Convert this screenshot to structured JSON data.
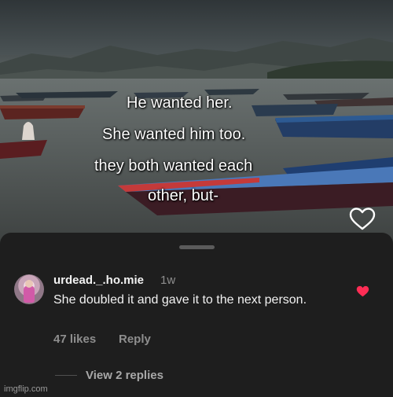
{
  "video": {
    "caption_lines": [
      "He wanted her.",
      "She wanted him too.",
      "they both wanted each",
      "other, but-"
    ],
    "like_icon": "heart-outline-icon"
  },
  "comment": {
    "username": "urdead._.ho.mie",
    "time": "1w",
    "text": "She doubled it and gave it to the next person.",
    "likes_label": "47 likes",
    "reply_label": "Reply",
    "liked_icon": "heart-filled-icon",
    "liked_color": "#ff2d55",
    "view_replies_label": "View 2 replies"
  },
  "watermark": "imgflip.com"
}
